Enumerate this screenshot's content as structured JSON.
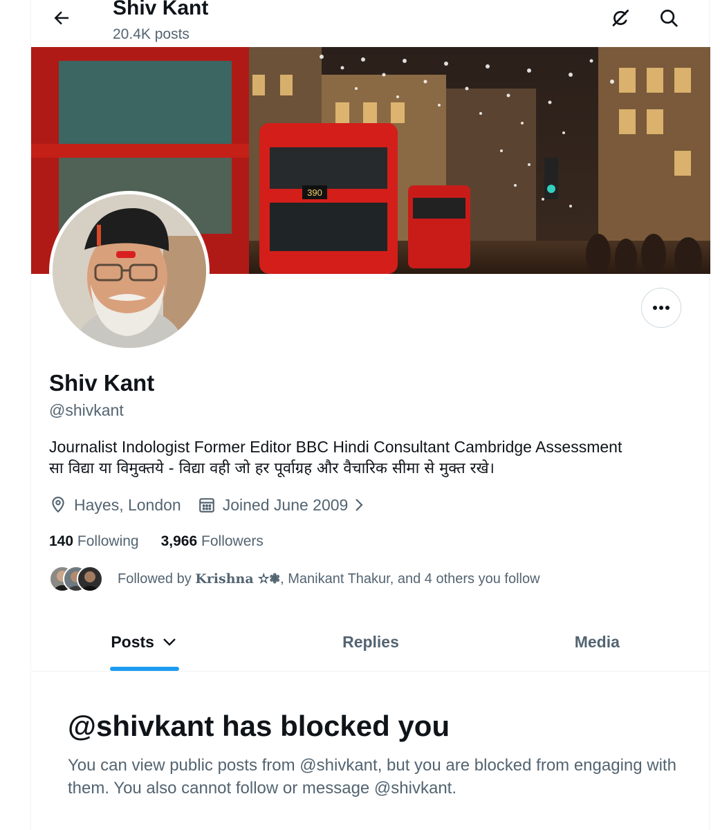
{
  "header": {
    "title": "Shiv Kant",
    "post_count": "20.4K posts"
  },
  "profile": {
    "display_name": "Shiv Kant",
    "handle": "@shivkant",
    "bio_line1": "Journalist Indologist Former Editor BBC Hindi Consultant Cambridge Assessment",
    "bio_line2": "सा विद्या या विमुक्तये - विद्या वही जो हर पूर्वाग्रह और वैचारिक सीमा से मुक्त रखे।",
    "location": "Hayes, London",
    "joined": "Joined June 2009",
    "following_count": "140",
    "following_label": "Following",
    "followers_count": "3,966",
    "followers_label": "Followers",
    "followed_by_prefix": "Followed by",
    "followed_by_name1": "Krishna ✫❃",
    "followed_by_rest": ", Manikant Thakur, and 4 others you follow"
  },
  "tabs": [
    {
      "label": "Posts",
      "active": true
    },
    {
      "label": "Replies",
      "active": false
    },
    {
      "label": "Media",
      "active": false
    }
  ],
  "blocked": {
    "title": "@shivkant has blocked you",
    "body": "You can view public posts from @shivkant, but you are blocked from engaging with them. You also cannot follow or message @shivkant."
  },
  "colors": {
    "accent": "#1d9bf0",
    "text_primary": "#0f1419",
    "text_secondary": "#536471"
  },
  "icons": {
    "back": "arrow-left-icon",
    "grok": "grok-icon",
    "search": "search-icon",
    "more": "more-horizontal-icon",
    "location": "location-pin-icon",
    "calendar": "calendar-icon"
  }
}
